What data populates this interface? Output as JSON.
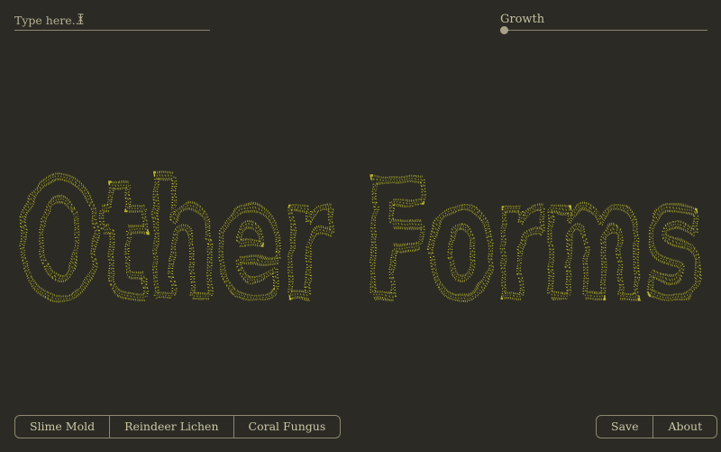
{
  "input": {
    "placeholder": "Type here..."
  },
  "growth": {
    "label": "Growth",
    "value": 0.0
  },
  "hero": {
    "text": "Other Forms"
  },
  "specimens": [
    "Slime Mold",
    "Reindeer Lichen",
    "Coral Fungus"
  ],
  "actions": [
    "Save",
    "About"
  ],
  "colors": {
    "background": "#2b2a24",
    "text": "#cbc6a6",
    "accent": "#c9c830",
    "line": "#8c8870"
  }
}
